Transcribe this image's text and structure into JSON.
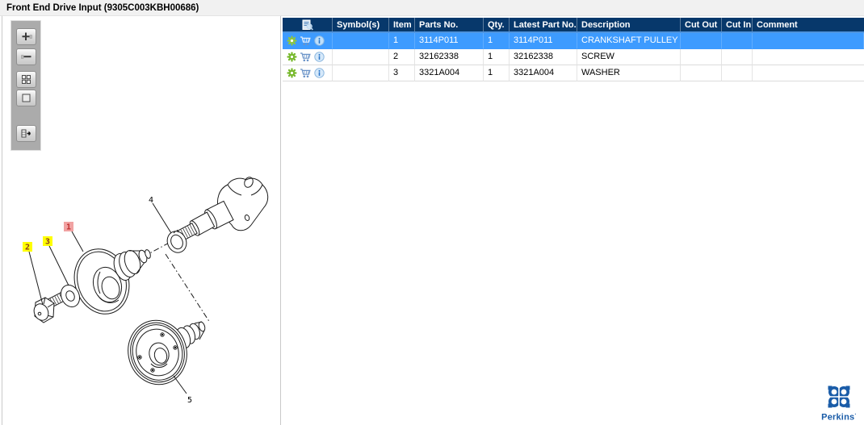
{
  "window": {
    "title": "Front End Drive Input (9305C003KBH00686)"
  },
  "toolbar": {
    "buttons": [
      {
        "icon": "zoom-in-icon"
      },
      {
        "icon": "zoom-out-icon"
      },
      {
        "icon": "tile-view-icon"
      },
      {
        "icon": "fit-view-icon"
      },
      {
        "icon": "go-to-list-icon"
      }
    ]
  },
  "diagram": {
    "callouts": [
      {
        "label": "1",
        "highlighted": true,
        "highlight_color": "#F1A2A2"
      },
      {
        "label": "2",
        "highlighted": true,
        "highlight_color": "#FFFF00"
      },
      {
        "label": "3",
        "highlighted": true,
        "highlight_color": "#FFFF00"
      },
      {
        "label": "4",
        "highlighted": false,
        "highlight_color": ""
      },
      {
        "label": "5",
        "highlighted": false,
        "highlight_color": ""
      }
    ]
  },
  "table": {
    "header_tool_icon": "report-magnifier-icon",
    "row_action_icons": [
      "gear-icon",
      "cart-icon",
      "info-icon"
    ],
    "columns": [
      "",
      "Symbol(s)",
      "Item",
      "Parts No.",
      "Qty.",
      "Latest Part No.",
      "Description",
      "Cut Out",
      "Cut In",
      "Comment"
    ],
    "rows": [
      {
        "selected": true,
        "symbols": "",
        "item": "1",
        "parts_no": "3114P011",
        "qty": "1",
        "latest_part_no": "3114P011",
        "description": "CRANKSHAFT PULLEY",
        "cut_out": "",
        "cut_in": "",
        "comment": ""
      },
      {
        "selected": false,
        "symbols": "",
        "item": "2",
        "parts_no": "32162338",
        "qty": "1",
        "latest_part_no": "32162338",
        "description": "SCREW",
        "cut_out": "",
        "cut_in": "",
        "comment": ""
      },
      {
        "selected": false,
        "symbols": "",
        "item": "3",
        "parts_no": "3321A004",
        "qty": "1",
        "latest_part_no": "3321A004",
        "description": "WASHER",
        "cut_out": "",
        "cut_in": "",
        "comment": ""
      }
    ]
  },
  "branding": {
    "logo_text": "Perkins",
    "trademark": "·"
  },
  "colors": {
    "table_header_bg": "#07386B",
    "selected_row_bg": "#3D9BFF",
    "callout_selected_bg": "#F1A2A2",
    "callout_highlight_bg": "#FFFF00",
    "logo_blue": "#1A5CA8",
    "gear_green": "#76B82A"
  }
}
